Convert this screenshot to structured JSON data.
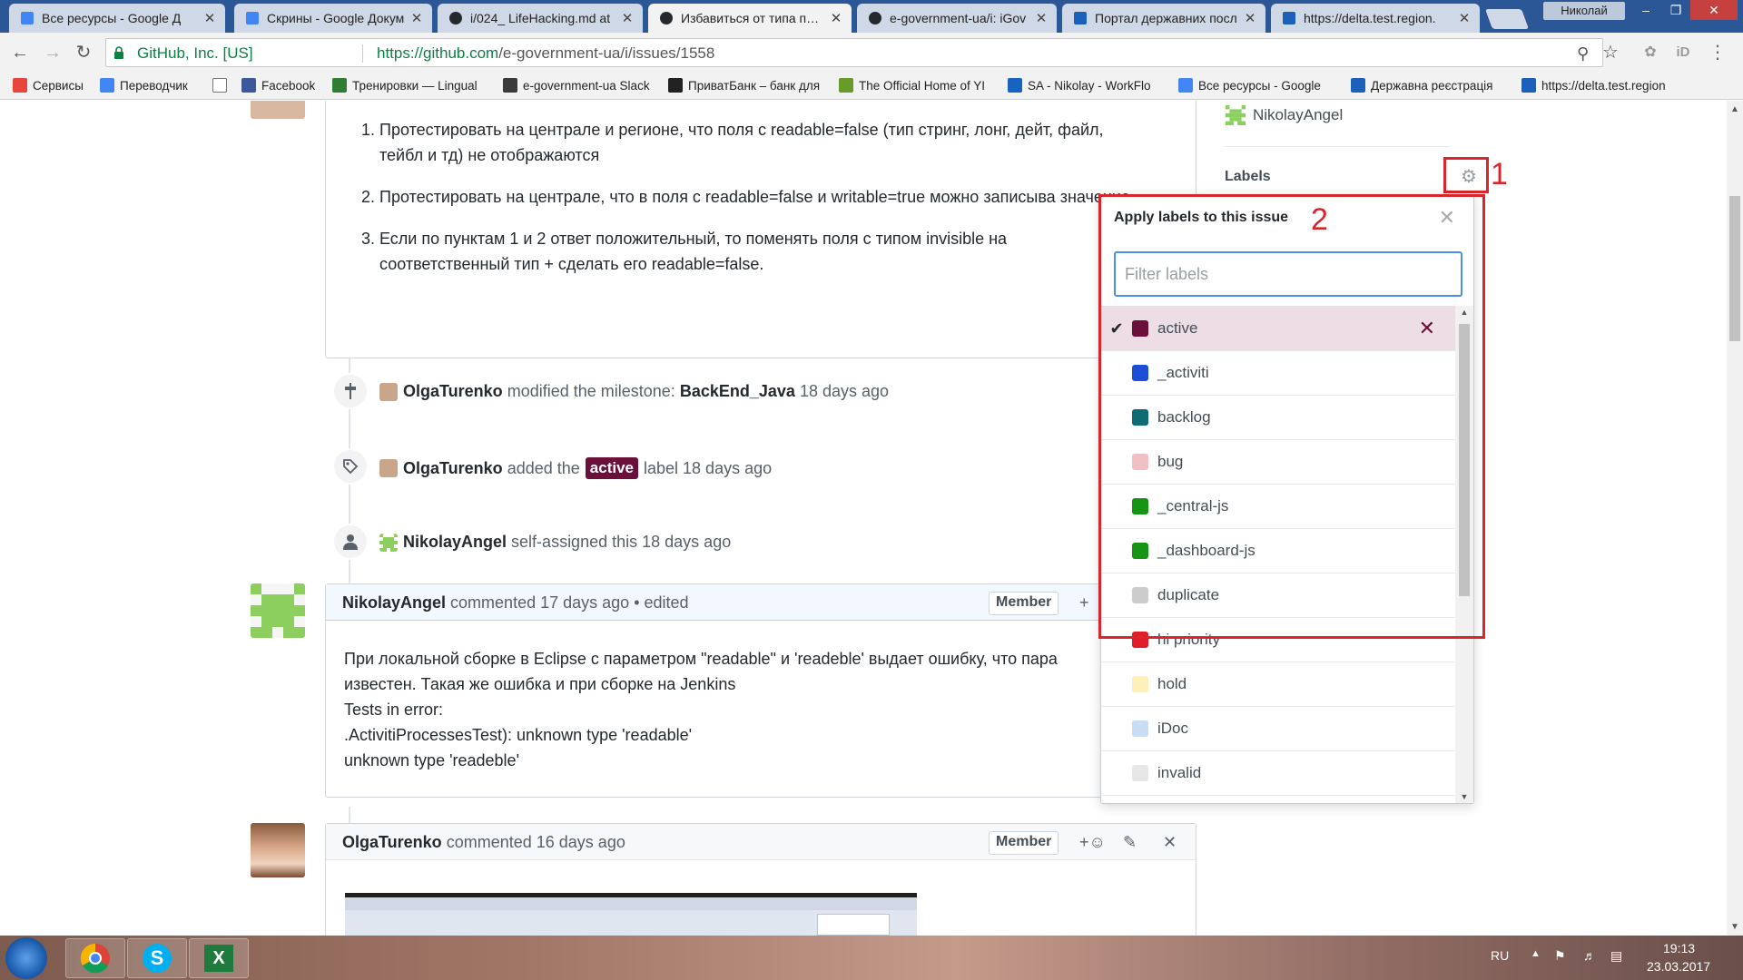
{
  "browser": {
    "tabs": [
      {
        "title": "Все ресурсы - Google Д",
        "icon": "google-docs-icon",
        "color": "#4285f4"
      },
      {
        "title": "Скрины - Google Докум",
        "icon": "google-docs-icon",
        "color": "#4285f4"
      },
      {
        "title": "i/024_ LifeHacking.md at",
        "icon": "github-icon",
        "color": "#24292e"
      },
      {
        "title": "Избавиться от типа поля",
        "icon": "github-icon",
        "color": "#24292e"
      },
      {
        "title": "e-government-ua/i: iGov",
        "icon": "github-icon",
        "color": "#24292e"
      },
      {
        "title": "Портал державних посл",
        "icon": "trident-icon",
        "color": "#1c5fb8"
      },
      {
        "title": "https://delta.test.region.",
        "icon": "trident-icon",
        "color": "#1c5fb8"
      }
    ],
    "user_chip": "Николай",
    "org_label": "GitHub, Inc. [US]",
    "url_scheme": "https://",
    "url_host": "github.com",
    "url_path": "/e-government-ua/i/issues/1558",
    "bookmarks": [
      {
        "label": "Сервисы",
        "icon": "apps-grid-icon",
        "color": "#e8453c"
      },
      {
        "label": "Переводчик",
        "icon": "translate-icon",
        "color": "#4285f4"
      },
      {
        "label": "",
        "icon": "page-icon",
        "color": "#ffffff"
      },
      {
        "label": "Facebook",
        "icon": "facebook-icon",
        "color": "#3b5998"
      },
      {
        "label": "Тренировки — Lingual",
        "icon": "lingualeo-icon",
        "color": "#2e7d32"
      },
      {
        "label": "e-government-ua Slack",
        "icon": "slack-icon",
        "color": "#3a3a3a"
      },
      {
        "label": "ПриватБанк – банк для",
        "icon": "privatbank-icon",
        "color": "#222222"
      },
      {
        "label": "The Official Home of YI",
        "icon": "yii-icon",
        "color": "#6a9a2a"
      },
      {
        "label": "SA - Nikolay - WorkFlo",
        "icon": "workflowy-icon",
        "color": "#1565c0"
      },
      {
        "label": "Все ресурсы - Google",
        "icon": "google-docs-icon",
        "color": "#4285f4"
      },
      {
        "label": "Державна реєстрація",
        "icon": "trident-icon",
        "color": "#1c5fb8"
      },
      {
        "label": "https://delta.test.region",
        "icon": "trident-icon",
        "color": "#1c5fb8"
      }
    ]
  },
  "issue": {
    "steps": [
      "Протестировать на централе и регионе, что поля с readable=false (тип стринг, лонг, дейт, файл, тейбл и тд) не отображаются",
      "Протестировать на централе, что в поля с readable=false и writable=true можно записыва значение.",
      "Если по пунктам 1 и 2 ответ положительный, то поменять поля с типом invisible на соответственный тип + сделать его readable=false."
    ],
    "events": [
      {
        "user": "OlgaTurenko",
        "text_before": "modified the milestone:",
        "target": "BackEnd_Java",
        "time": "18 days ago",
        "icon": "milestone-icon"
      },
      {
        "user": "OlgaTurenko",
        "text_before": "added the",
        "label": "active",
        "text_after": "label",
        "time": "18 days ago",
        "icon": "tag-icon"
      },
      {
        "user": "NikolayAngel",
        "text_before": "self-assigned this",
        "time": "18 days ago",
        "icon": "person-icon"
      }
    ],
    "comment1": {
      "user": "NikolayAngel",
      "action": "commented",
      "time": "17 days ago",
      "edited": "• edited",
      "badge": "Member",
      "plus": "+",
      "lines": [
        "При локальной сборке в Eclipse с параметром \"readable\" и 'readeble' выдает ошибку, что пара",
        "известен. Такая же ошибка и при сборке на Jenkins",
        "Tests in error:",
        ".ActivitiProcessesTest): unknown type 'readable'",
        "unknown type 'readeble'"
      ]
    },
    "comment2": {
      "user": "OlgaTurenko",
      "action": "commented",
      "time": "16 days ago",
      "badge": "Member",
      "plus": "+"
    }
  },
  "sidebar": {
    "assignee": "NikolayAngel",
    "labels_heading": "Labels",
    "annotation_1": "1",
    "annotation_2": "2"
  },
  "popup": {
    "title": "Apply labels to this issue",
    "filter_placeholder": "Filter labels",
    "labels": [
      {
        "name": "active",
        "color": "#6b0f3b",
        "selected": true
      },
      {
        "name": "_activiti",
        "color": "#1d4ed8",
        "selected": false
      },
      {
        "name": "backlog",
        "color": "#0e6b74",
        "selected": false
      },
      {
        "name": "bug",
        "color": "#f2c0c4",
        "selected": false
      },
      {
        "name": "_central-js",
        "color": "#159415",
        "selected": false
      },
      {
        "name": "_dashboard-js",
        "color": "#159415",
        "selected": false
      },
      {
        "name": "duplicate",
        "color": "#cccccc",
        "selected": false
      },
      {
        "name": "hi priority",
        "color": "#e11d2a",
        "selected": false
      },
      {
        "name": "hold",
        "color": "#fdf0b8",
        "selected": false
      },
      {
        "name": "iDoc",
        "color": "#c8dcf4",
        "selected": false
      },
      {
        "name": "invalid",
        "color": "#e6e6e6",
        "selected": false
      }
    ]
  },
  "taskbar": {
    "lang": "RU",
    "time": "19:13",
    "date": "23.03.2017"
  }
}
